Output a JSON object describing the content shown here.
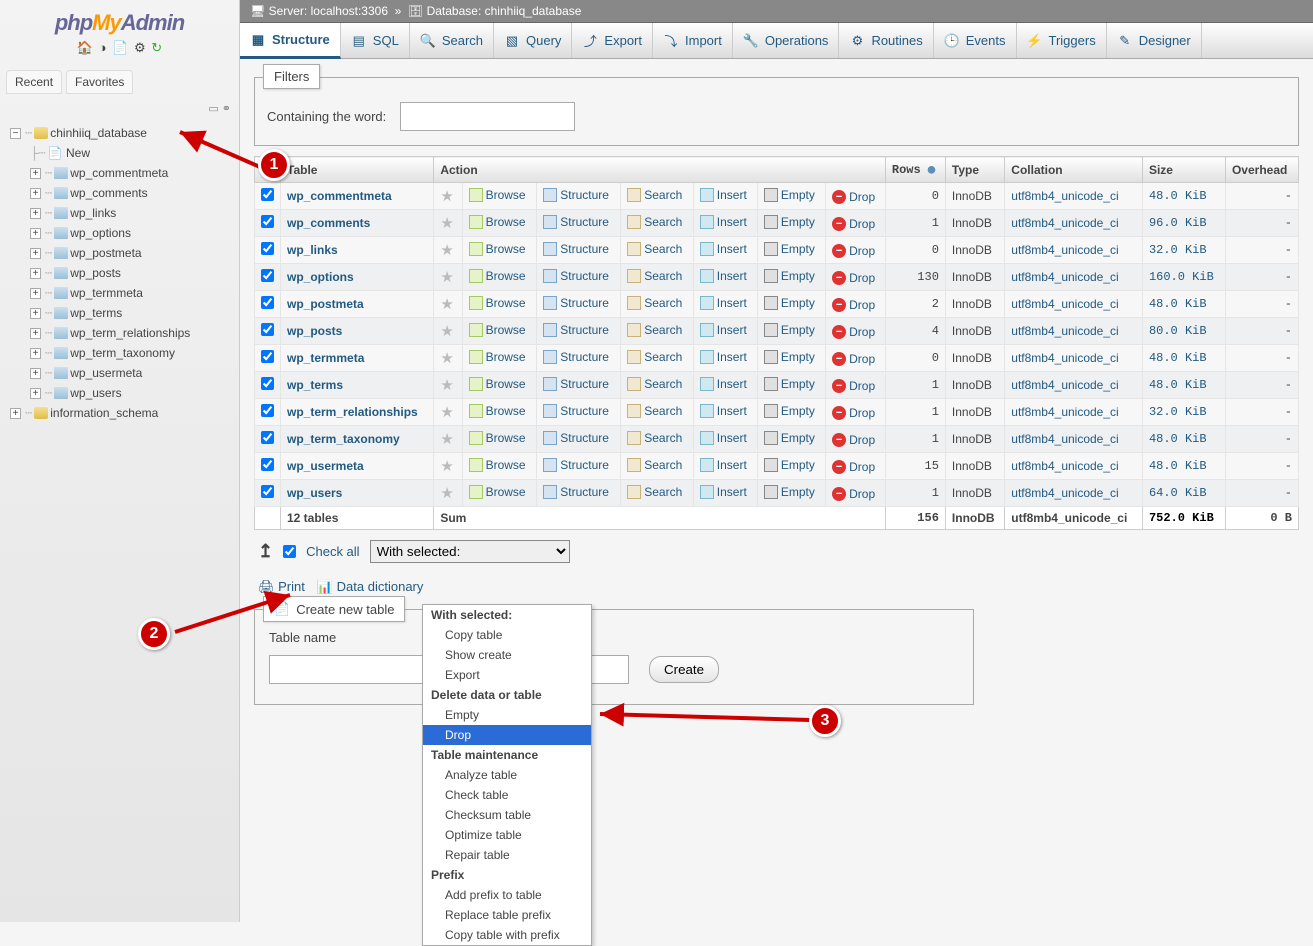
{
  "logo": {
    "p1": "php",
    "p2": "My",
    "p3": "Admin"
  },
  "sidebar": {
    "tabs": [
      "Recent",
      "Favorites"
    ],
    "db": "chinhiiq_database",
    "new_label": "New",
    "tables": [
      "wp_commentmeta",
      "wp_comments",
      "wp_links",
      "wp_options",
      "wp_postmeta",
      "wp_posts",
      "wp_termmeta",
      "wp_terms",
      "wp_term_relationships",
      "wp_term_taxonomy",
      "wp_usermeta",
      "wp_users"
    ],
    "other_db": "information_schema"
  },
  "breadcrumb": {
    "server_label": "Server:",
    "server": "localhost:3306",
    "db_label": "Database:",
    "db": "chinhiiq_database"
  },
  "toptabs": [
    "Structure",
    "SQL",
    "Search",
    "Query",
    "Export",
    "Import",
    "Operations",
    "Routines",
    "Events",
    "Triggers",
    "Designer"
  ],
  "filters": {
    "legend": "Filters",
    "label": "Containing the word:"
  },
  "columns": {
    "table": "Table",
    "action": "Action",
    "rows": "Rows",
    "type": "Type",
    "collation": "Collation",
    "size": "Size",
    "overhead": "Overhead"
  },
  "actions": {
    "browse": "Browse",
    "structure": "Structure",
    "search": "Search",
    "insert": "Insert",
    "empty": "Empty",
    "drop": "Drop"
  },
  "rows": [
    {
      "name": "wp_commentmeta",
      "rows": 0,
      "type": "InnoDB",
      "collation": "utf8mb4_unicode_ci",
      "size": "48.0 KiB",
      "overhead": "-"
    },
    {
      "name": "wp_comments",
      "rows": 1,
      "type": "InnoDB",
      "collation": "utf8mb4_unicode_ci",
      "size": "96.0 KiB",
      "overhead": "-"
    },
    {
      "name": "wp_links",
      "rows": 0,
      "type": "InnoDB",
      "collation": "utf8mb4_unicode_ci",
      "size": "32.0 KiB",
      "overhead": "-"
    },
    {
      "name": "wp_options",
      "rows": 130,
      "type": "InnoDB",
      "collation": "utf8mb4_unicode_ci",
      "size": "160.0 KiB",
      "overhead": "-"
    },
    {
      "name": "wp_postmeta",
      "rows": 2,
      "type": "InnoDB",
      "collation": "utf8mb4_unicode_ci",
      "size": "48.0 KiB",
      "overhead": "-"
    },
    {
      "name": "wp_posts",
      "rows": 4,
      "type": "InnoDB",
      "collation": "utf8mb4_unicode_ci",
      "size": "80.0 KiB",
      "overhead": "-"
    },
    {
      "name": "wp_termmeta",
      "rows": 0,
      "type": "InnoDB",
      "collation": "utf8mb4_unicode_ci",
      "size": "48.0 KiB",
      "overhead": "-"
    },
    {
      "name": "wp_terms",
      "rows": 1,
      "type": "InnoDB",
      "collation": "utf8mb4_unicode_ci",
      "size": "48.0 KiB",
      "overhead": "-"
    },
    {
      "name": "wp_term_relationships",
      "rows": 1,
      "type": "InnoDB",
      "collation": "utf8mb4_unicode_ci",
      "size": "32.0 KiB",
      "overhead": "-"
    },
    {
      "name": "wp_term_taxonomy",
      "rows": 1,
      "type": "InnoDB",
      "collation": "utf8mb4_unicode_ci",
      "size": "48.0 KiB",
      "overhead": "-"
    },
    {
      "name": "wp_usermeta",
      "rows": 15,
      "type": "InnoDB",
      "collation": "utf8mb4_unicode_ci",
      "size": "48.0 KiB",
      "overhead": "-"
    },
    {
      "name": "wp_users",
      "rows": 1,
      "type": "InnoDB",
      "collation": "utf8mb4_unicode_ci",
      "size": "64.0 KiB",
      "overhead": "-"
    }
  ],
  "sum": {
    "label": "12 tables",
    "sum": "Sum",
    "rows": 156,
    "type": "InnoDB",
    "collation": "utf8mb4_unicode_ci",
    "size": "752.0 KiB",
    "overhead": "0 B"
  },
  "checkall": {
    "label": "Check all",
    "select_label": "With selected:"
  },
  "dropdown": {
    "groups": [
      {
        "header": "With selected:",
        "opts": [
          "Copy table",
          "Show create",
          "Export"
        ]
      },
      {
        "header": "Delete data or table",
        "opts": [
          "Empty",
          "Drop"
        ]
      },
      {
        "header": "Table maintenance",
        "opts": [
          "Analyze table",
          "Check table",
          "Checksum table",
          "Optimize table",
          "Repair table"
        ]
      },
      {
        "header": "Prefix",
        "opts": [
          "Add prefix to table",
          "Replace table prefix",
          "Copy table with prefix"
        ]
      }
    ],
    "highlight": "Drop"
  },
  "links": {
    "print": "Print",
    "dict": "Data dictionary"
  },
  "newtable": {
    "legend": "Create new table",
    "name_label": "Table name",
    "create": "Create"
  },
  "anno": {
    "1": "1",
    "2": "2",
    "3": "3"
  }
}
